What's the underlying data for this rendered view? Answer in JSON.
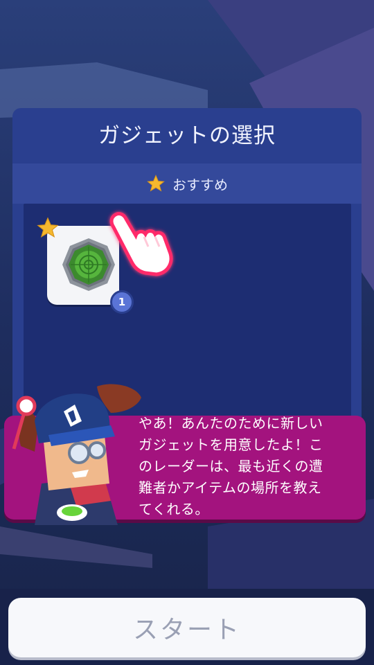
{
  "panel": {
    "title": "ガジェットの選択",
    "recommend_label": "おすすめ"
  },
  "gadgets": [
    {
      "icon": "radar-icon",
      "count": "1",
      "recommended": true
    }
  ],
  "dialog": {
    "text": "やあ！あんたのために新しい\nガジェットを用意したよ！こ\nのレーダーは、最も近くの遭\n難者かアイテムの場所を教え\nてくれる。"
  },
  "footer": {
    "start_label": "スタート"
  },
  "colors": {
    "panel": "#2a3f8f",
    "gadget_area": "#1d2d72",
    "dialog": "#a3137e",
    "star": "#f5b82e",
    "badge": "#5a74d6"
  }
}
